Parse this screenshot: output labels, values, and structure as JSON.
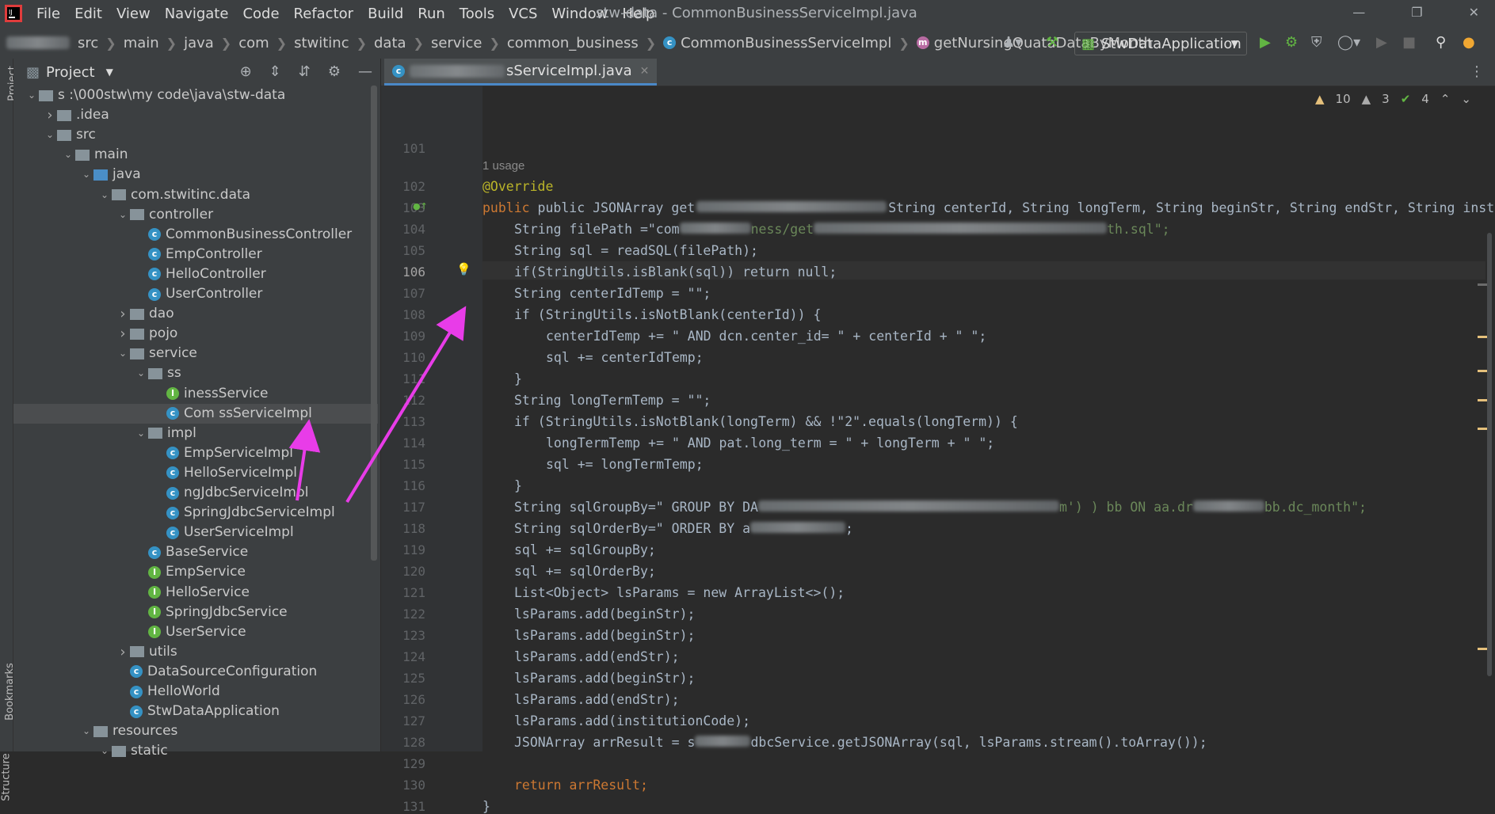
{
  "menubar": {
    "items": [
      "File",
      "Edit",
      "View",
      "Navigate",
      "Code",
      "Refactor",
      "Build",
      "Run",
      "Tools",
      "VCS",
      "Window",
      "Help"
    ],
    "title": "stw-data - CommonBusinessServiceImpl.java"
  },
  "navbar": {
    "crumbs": [
      "src",
      "main",
      "java",
      "com",
      "stwitinc",
      "data",
      "service",
      "common_business"
    ],
    "class_crumb": "CommonBusinessServiceImpl",
    "method_crumb": "getNursingQuataDataByMonth",
    "run_config": "StwDataApplication"
  },
  "project": {
    "title": "Project",
    "tree": [
      {
        "label": "s       :\\000stw\\my code\\java\\stw-data",
        "indent": 0,
        "kind": "folder",
        "expanded": true
      },
      {
        "label": ".idea",
        "indent": 1,
        "kind": "folder",
        "expanded": false
      },
      {
        "label": "src",
        "indent": 1,
        "kind": "folder",
        "expanded": true
      },
      {
        "label": "main",
        "indent": 2,
        "kind": "folder",
        "expanded": true
      },
      {
        "label": "java",
        "indent": 3,
        "kind": "folder-blue",
        "expanded": true
      },
      {
        "label": "com.stwitinc.data",
        "indent": 4,
        "kind": "pkg",
        "expanded": true
      },
      {
        "label": "controller",
        "indent": 5,
        "kind": "pkg",
        "expanded": true
      },
      {
        "label": "CommonBusinessController",
        "indent": 6,
        "kind": "class"
      },
      {
        "label": "EmpController",
        "indent": 6,
        "kind": "class"
      },
      {
        "label": "HelloController",
        "indent": 6,
        "kind": "class"
      },
      {
        "label": "UserController",
        "indent": 6,
        "kind": "class"
      },
      {
        "label": "dao",
        "indent": 5,
        "kind": "pkg",
        "expanded": false
      },
      {
        "label": "pojo",
        "indent": 5,
        "kind": "pkg",
        "expanded": false
      },
      {
        "label": "service",
        "indent": 5,
        "kind": "pkg",
        "expanded": true
      },
      {
        "label": "ss",
        "indent": 6,
        "kind": "pkg",
        "expanded": true
      },
      {
        "label": "inessService",
        "indent": 7,
        "kind": "interface"
      },
      {
        "label": "Com         ssServiceImpl",
        "indent": 7,
        "kind": "class",
        "selected": true
      },
      {
        "label": "impl",
        "indent": 6,
        "kind": "pkg",
        "expanded": true
      },
      {
        "label": "EmpServiceImpl",
        "indent": 7,
        "kind": "class"
      },
      {
        "label": "HelloServiceImpl",
        "indent": 7,
        "kind": "class"
      },
      {
        "label": "ngJdbcServiceImpl",
        "indent": 7,
        "kind": "class"
      },
      {
        "label": "SpringJdbcServiceImpl",
        "indent": 7,
        "kind": "class"
      },
      {
        "label": "UserServiceImpl",
        "indent": 7,
        "kind": "class"
      },
      {
        "label": "BaseService",
        "indent": 6,
        "kind": "class"
      },
      {
        "label": "EmpService",
        "indent": 6,
        "kind": "interface"
      },
      {
        "label": "HelloService",
        "indent": 6,
        "kind": "interface"
      },
      {
        "label": "SpringJdbcService",
        "indent": 6,
        "kind": "interface"
      },
      {
        "label": "UserService",
        "indent": 6,
        "kind": "interface"
      },
      {
        "label": "utils",
        "indent": 5,
        "kind": "pkg",
        "expanded": false
      },
      {
        "label": "DataSourceConfiguration",
        "indent": 5,
        "kind": "class"
      },
      {
        "label": "HelloWorld",
        "indent": 5,
        "kind": "class"
      },
      {
        "label": "StwDataApplication",
        "indent": 5,
        "kind": "class"
      },
      {
        "label": "resources",
        "indent": 3,
        "kind": "folder",
        "expanded": true
      },
      {
        "label": "static",
        "indent": 4,
        "kind": "folder",
        "expanded": true
      }
    ]
  },
  "side_labels": {
    "project": "Project",
    "bookmarks": "Bookmarks",
    "structure": "Structure"
  },
  "editor": {
    "tab_label": "sServiceImpl.java",
    "usage_hint": "1 usage",
    "inspections": {
      "warnings": "10",
      "weak": "3",
      "ok": "4"
    },
    "line_numbers": [
      "101",
      "102",
      "103",
      "104",
      "105",
      "106",
      "107",
      "108",
      "109",
      "110",
      "111",
      "112",
      "113",
      "114",
      "115",
      "116",
      "117",
      "118",
      "119",
      "120",
      "121",
      "122",
      "123",
      "124",
      "125",
      "126",
      "127",
      "128",
      "129",
      "130",
      "131"
    ],
    "lines": {
      "l102": "@Override",
      "l103a": "public JSONArray get",
      "l103b": "String centerId, String longTerm, String beginStr, String endStr, String institution",
      "l104a": "String filePath =\"com",
      "l104b": "ness/get",
      "l104c": "th.sql\";",
      "l105": "String sql = readSQL(filePath);",
      "l106": "if(StringUtils.isBlank(sql)) return null;",
      "l107": "String centerIdTemp = \"\";",
      "l108": "if (StringUtils.isNotBlank(centerId)) {",
      "l109": "centerIdTemp += \" AND dcn.center_id= \" + centerId + \" \";",
      "l110": "sql += centerIdTemp;",
      "l111": "}",
      "l112": "String longTermTemp = \"\";",
      "l113": "if (StringUtils.isNotBlank(longTerm) && !\"2\".equals(longTerm)) {",
      "l114": "longTermTemp += \" AND pat.long_term = \" + longTerm + \" \";",
      "l115": "sql += longTermTemp;",
      "l116": "}",
      "l117a": "String sqlGroupBy=\" GROUP BY DA",
      "l117b": "m') ) bb ON aa.dr",
      "l117c": "bb.dc_month\";",
      "l118a": "String sqlOrderBy=\" ORDER BY a",
      "l118b": ";",
      "l119": "sql += sqlGroupBy;",
      "l120": "sql += sqlOrderBy;",
      "l121": "List<Object> lsParams = new ArrayList<>();",
      "l122": "lsParams.add(beginStr);",
      "l123": "lsParams.add(beginStr);",
      "l124": "lsParams.add(endStr);",
      "l125": "lsParams.add(beginStr);",
      "l126": "lsParams.add(endStr);",
      "l127": "lsParams.add(institutionCode);",
      "l128a": "JSONArray arrResult = s",
      "l128b": "dbcService.getJSONArray(sql, lsParams.stream().toArray());",
      "l130": "return arrResult;",
      "l131": "}"
    }
  },
  "colors": {
    "keyword": "#cc7832",
    "string": "#6a8759",
    "annotation": "#bbb529",
    "method": "#ffc66d",
    "arrow": "#e83ce8"
  }
}
